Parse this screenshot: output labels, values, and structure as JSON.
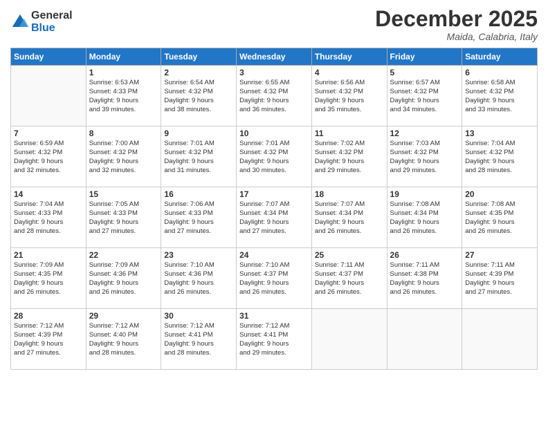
{
  "logo": {
    "general": "General",
    "blue": "Blue"
  },
  "title": "December 2025",
  "location": "Maida, Calabria, Italy",
  "days_header": [
    "Sunday",
    "Monday",
    "Tuesday",
    "Wednesday",
    "Thursday",
    "Friday",
    "Saturday"
  ],
  "weeks": [
    [
      {
        "num": "",
        "info": ""
      },
      {
        "num": "1",
        "info": "Sunrise: 6:53 AM\nSunset: 4:33 PM\nDaylight: 9 hours\nand 39 minutes."
      },
      {
        "num": "2",
        "info": "Sunrise: 6:54 AM\nSunset: 4:32 PM\nDaylight: 9 hours\nand 38 minutes."
      },
      {
        "num": "3",
        "info": "Sunrise: 6:55 AM\nSunset: 4:32 PM\nDaylight: 9 hours\nand 36 minutes."
      },
      {
        "num": "4",
        "info": "Sunrise: 6:56 AM\nSunset: 4:32 PM\nDaylight: 9 hours\nand 35 minutes."
      },
      {
        "num": "5",
        "info": "Sunrise: 6:57 AM\nSunset: 4:32 PM\nDaylight: 9 hours\nand 34 minutes."
      },
      {
        "num": "6",
        "info": "Sunrise: 6:58 AM\nSunset: 4:32 PM\nDaylight: 9 hours\nand 33 minutes."
      }
    ],
    [
      {
        "num": "7",
        "info": "Sunrise: 6:59 AM\nSunset: 4:32 PM\nDaylight: 9 hours\nand 32 minutes."
      },
      {
        "num": "8",
        "info": "Sunrise: 7:00 AM\nSunset: 4:32 PM\nDaylight: 9 hours\nand 32 minutes."
      },
      {
        "num": "9",
        "info": "Sunrise: 7:01 AM\nSunset: 4:32 PM\nDaylight: 9 hours\nand 31 minutes."
      },
      {
        "num": "10",
        "info": "Sunrise: 7:01 AM\nSunset: 4:32 PM\nDaylight: 9 hours\nand 30 minutes."
      },
      {
        "num": "11",
        "info": "Sunrise: 7:02 AM\nSunset: 4:32 PM\nDaylight: 9 hours\nand 29 minutes."
      },
      {
        "num": "12",
        "info": "Sunrise: 7:03 AM\nSunset: 4:32 PM\nDaylight: 9 hours\nand 29 minutes."
      },
      {
        "num": "13",
        "info": "Sunrise: 7:04 AM\nSunset: 4:32 PM\nDaylight: 9 hours\nand 28 minutes."
      }
    ],
    [
      {
        "num": "14",
        "info": "Sunrise: 7:04 AM\nSunset: 4:33 PM\nDaylight: 9 hours\nand 28 minutes."
      },
      {
        "num": "15",
        "info": "Sunrise: 7:05 AM\nSunset: 4:33 PM\nDaylight: 9 hours\nand 27 minutes."
      },
      {
        "num": "16",
        "info": "Sunrise: 7:06 AM\nSunset: 4:33 PM\nDaylight: 9 hours\nand 27 minutes."
      },
      {
        "num": "17",
        "info": "Sunrise: 7:07 AM\nSunset: 4:34 PM\nDaylight: 9 hours\nand 27 minutes."
      },
      {
        "num": "18",
        "info": "Sunrise: 7:07 AM\nSunset: 4:34 PM\nDaylight: 9 hours\nand 26 minutes."
      },
      {
        "num": "19",
        "info": "Sunrise: 7:08 AM\nSunset: 4:34 PM\nDaylight: 9 hours\nand 26 minutes."
      },
      {
        "num": "20",
        "info": "Sunrise: 7:08 AM\nSunset: 4:35 PM\nDaylight: 9 hours\nand 26 minutes."
      }
    ],
    [
      {
        "num": "21",
        "info": "Sunrise: 7:09 AM\nSunset: 4:35 PM\nDaylight: 9 hours\nand 26 minutes."
      },
      {
        "num": "22",
        "info": "Sunrise: 7:09 AM\nSunset: 4:36 PM\nDaylight: 9 hours\nand 26 minutes."
      },
      {
        "num": "23",
        "info": "Sunrise: 7:10 AM\nSunset: 4:36 PM\nDaylight: 9 hours\nand 26 minutes."
      },
      {
        "num": "24",
        "info": "Sunrise: 7:10 AM\nSunset: 4:37 PM\nDaylight: 9 hours\nand 26 minutes."
      },
      {
        "num": "25",
        "info": "Sunrise: 7:11 AM\nSunset: 4:37 PM\nDaylight: 9 hours\nand 26 minutes."
      },
      {
        "num": "26",
        "info": "Sunrise: 7:11 AM\nSunset: 4:38 PM\nDaylight: 9 hours\nand 26 minutes."
      },
      {
        "num": "27",
        "info": "Sunrise: 7:11 AM\nSunset: 4:39 PM\nDaylight: 9 hours\nand 27 minutes."
      }
    ],
    [
      {
        "num": "28",
        "info": "Sunrise: 7:12 AM\nSunset: 4:39 PM\nDaylight: 9 hours\nand 27 minutes."
      },
      {
        "num": "29",
        "info": "Sunrise: 7:12 AM\nSunset: 4:40 PM\nDaylight: 9 hours\nand 28 minutes."
      },
      {
        "num": "30",
        "info": "Sunrise: 7:12 AM\nSunset: 4:41 PM\nDaylight: 9 hours\nand 28 minutes."
      },
      {
        "num": "31",
        "info": "Sunrise: 7:12 AM\nSunset: 4:41 PM\nDaylight: 9 hours\nand 29 minutes."
      },
      {
        "num": "",
        "info": ""
      },
      {
        "num": "",
        "info": ""
      },
      {
        "num": "",
        "info": ""
      }
    ]
  ]
}
